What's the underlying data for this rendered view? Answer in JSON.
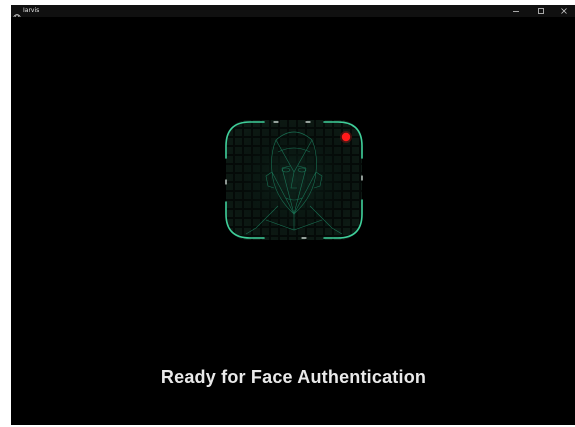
{
  "window": {
    "title": "Iarvis",
    "controls": {
      "minimize": "minimize-icon",
      "maximize": "maximize-icon",
      "close": "close-icon"
    }
  },
  "scanner": {
    "icon": "face-scan-icon",
    "indicator_color": "#ff1a1a",
    "frame_color": "#3fcf9a"
  },
  "status": {
    "message": "Ready for Face Authentication"
  }
}
